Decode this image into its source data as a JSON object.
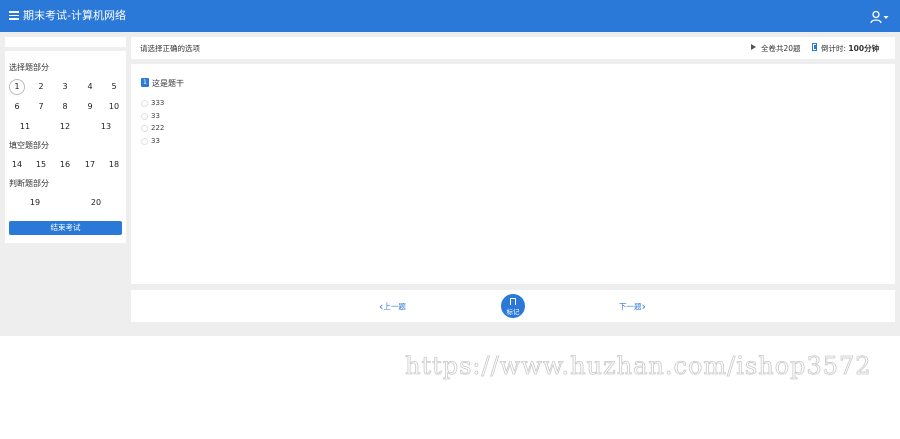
{
  "header": {
    "title": "期末考试-计算机网络"
  },
  "sidebar": {
    "sections": [
      {
        "title": "选择题部分",
        "numbers": [
          "1",
          "2",
          "3",
          "4",
          "5",
          "6",
          "7",
          "8",
          "9",
          "10",
          "11",
          "12",
          "13"
        ]
      },
      {
        "title": "填空题部分",
        "numbers": [
          "14",
          "15",
          "16",
          "17",
          "18"
        ]
      },
      {
        "title": "判断题部分",
        "numbers": [
          "19",
          "20"
        ]
      }
    ],
    "end_button": "结束考试"
  },
  "topbar": {
    "instruction": "请选择正确的选项",
    "total": "全卷共20题",
    "timer_label": "倒计时:",
    "timer_value": "100分钟"
  },
  "question": {
    "badge": "1",
    "stem": "这是题干",
    "options": [
      "333",
      "33",
      "222",
      "33"
    ]
  },
  "nav": {
    "prev": "上一题",
    "mark": "标记",
    "next": "下一题"
  },
  "watermark": "https://www.huzhan.com/ishop3572",
  "colors": {
    "accent": "#2a78d8",
    "background": "#eeeeee"
  }
}
